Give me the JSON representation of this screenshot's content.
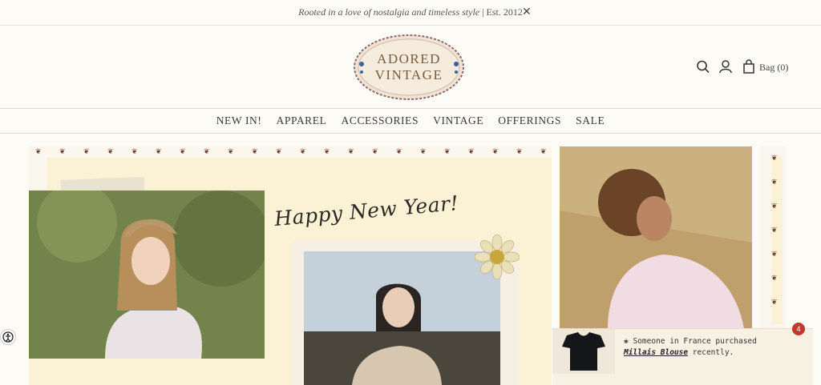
{
  "announcement": {
    "text_italic": "Rooted in a love of nostalgia and timeless style",
    "text_rest": " | Est. 2012",
    "close_icon": "close-icon"
  },
  "logo": {
    "line1": "ADORED",
    "line2": "VINTAGE"
  },
  "header": {
    "bag_label": "Bag (0)"
  },
  "nav": {
    "items": [
      "NEW IN!",
      "APPAREL",
      "ACCESSORIES",
      "VINTAGE",
      "OFFERINGS",
      "SALE"
    ]
  },
  "hero": {
    "script_text": "Happy New Year!"
  },
  "toast": {
    "line1": "❀ Someone in France purchased",
    "product": "Millais Blouse",
    "suffix": " recently."
  },
  "badge": {
    "count": "4"
  },
  "colors": {
    "background": "#fdfbf6",
    "hero_panel": "#fbf1d5",
    "logo_text": "#7a5a3a",
    "badge": "#c0392b"
  }
}
